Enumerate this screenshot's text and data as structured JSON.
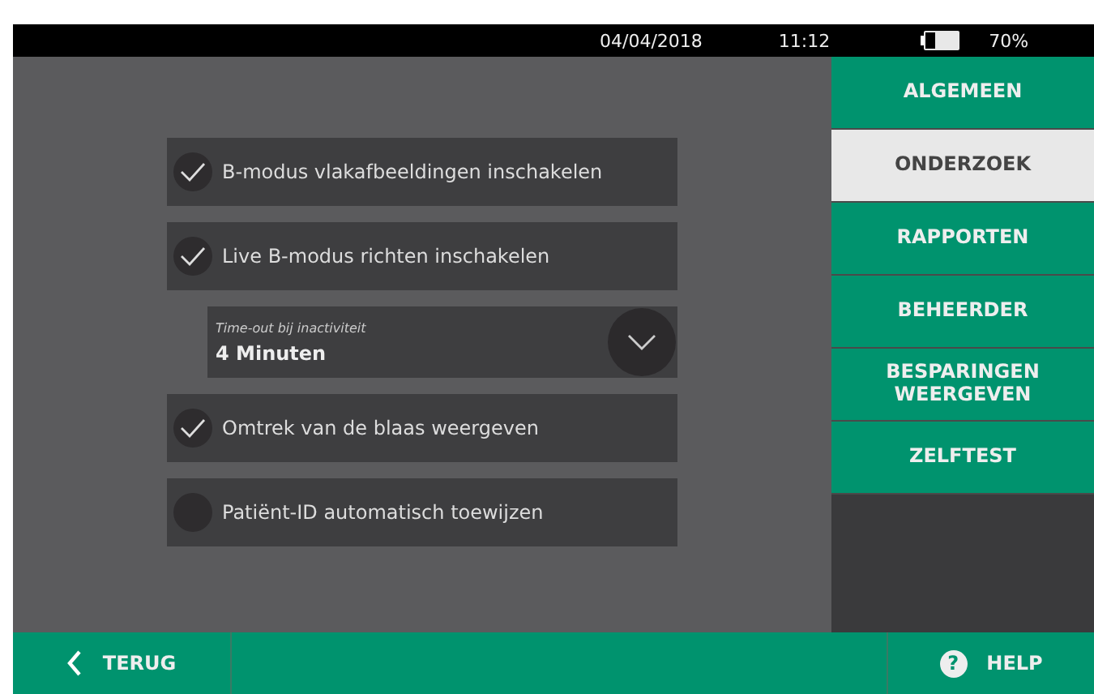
{
  "status_bar": {
    "date": "04/04/2018",
    "time": "11:12",
    "battery": "70%"
  },
  "settings": [
    {
      "kind": "checkbox",
      "label": "B-modus vlakafbeeldingen inschakelen",
      "checked": true
    },
    {
      "kind": "checkbox",
      "label": "Live B-modus richten inschakelen",
      "checked": true
    },
    {
      "kind": "dropdown",
      "label": "Time-out bij inactiviteit",
      "value": "4 Minuten"
    },
    {
      "kind": "checkbox",
      "label": "Omtrek van de blaas weergeven",
      "checked": true
    },
    {
      "kind": "checkbox",
      "label": "Patiënt-ID automatisch toewijzen",
      "checked": false
    }
  ],
  "sidebar": {
    "items": [
      {
        "label": "ALGEMEEN",
        "selected": false
      },
      {
        "label": "ONDERZOEK",
        "selected": true
      },
      {
        "label": "RAPPORTEN",
        "selected": false
      },
      {
        "label": "BEHEERDER",
        "selected": false
      },
      {
        "label": "BESPARINGEN WEERGEVEN",
        "selected": false
      },
      {
        "label": "ZELFTEST",
        "selected": false
      }
    ]
  },
  "footer": {
    "back": "TERUG",
    "help": "HELP",
    "help_icon": "?"
  }
}
